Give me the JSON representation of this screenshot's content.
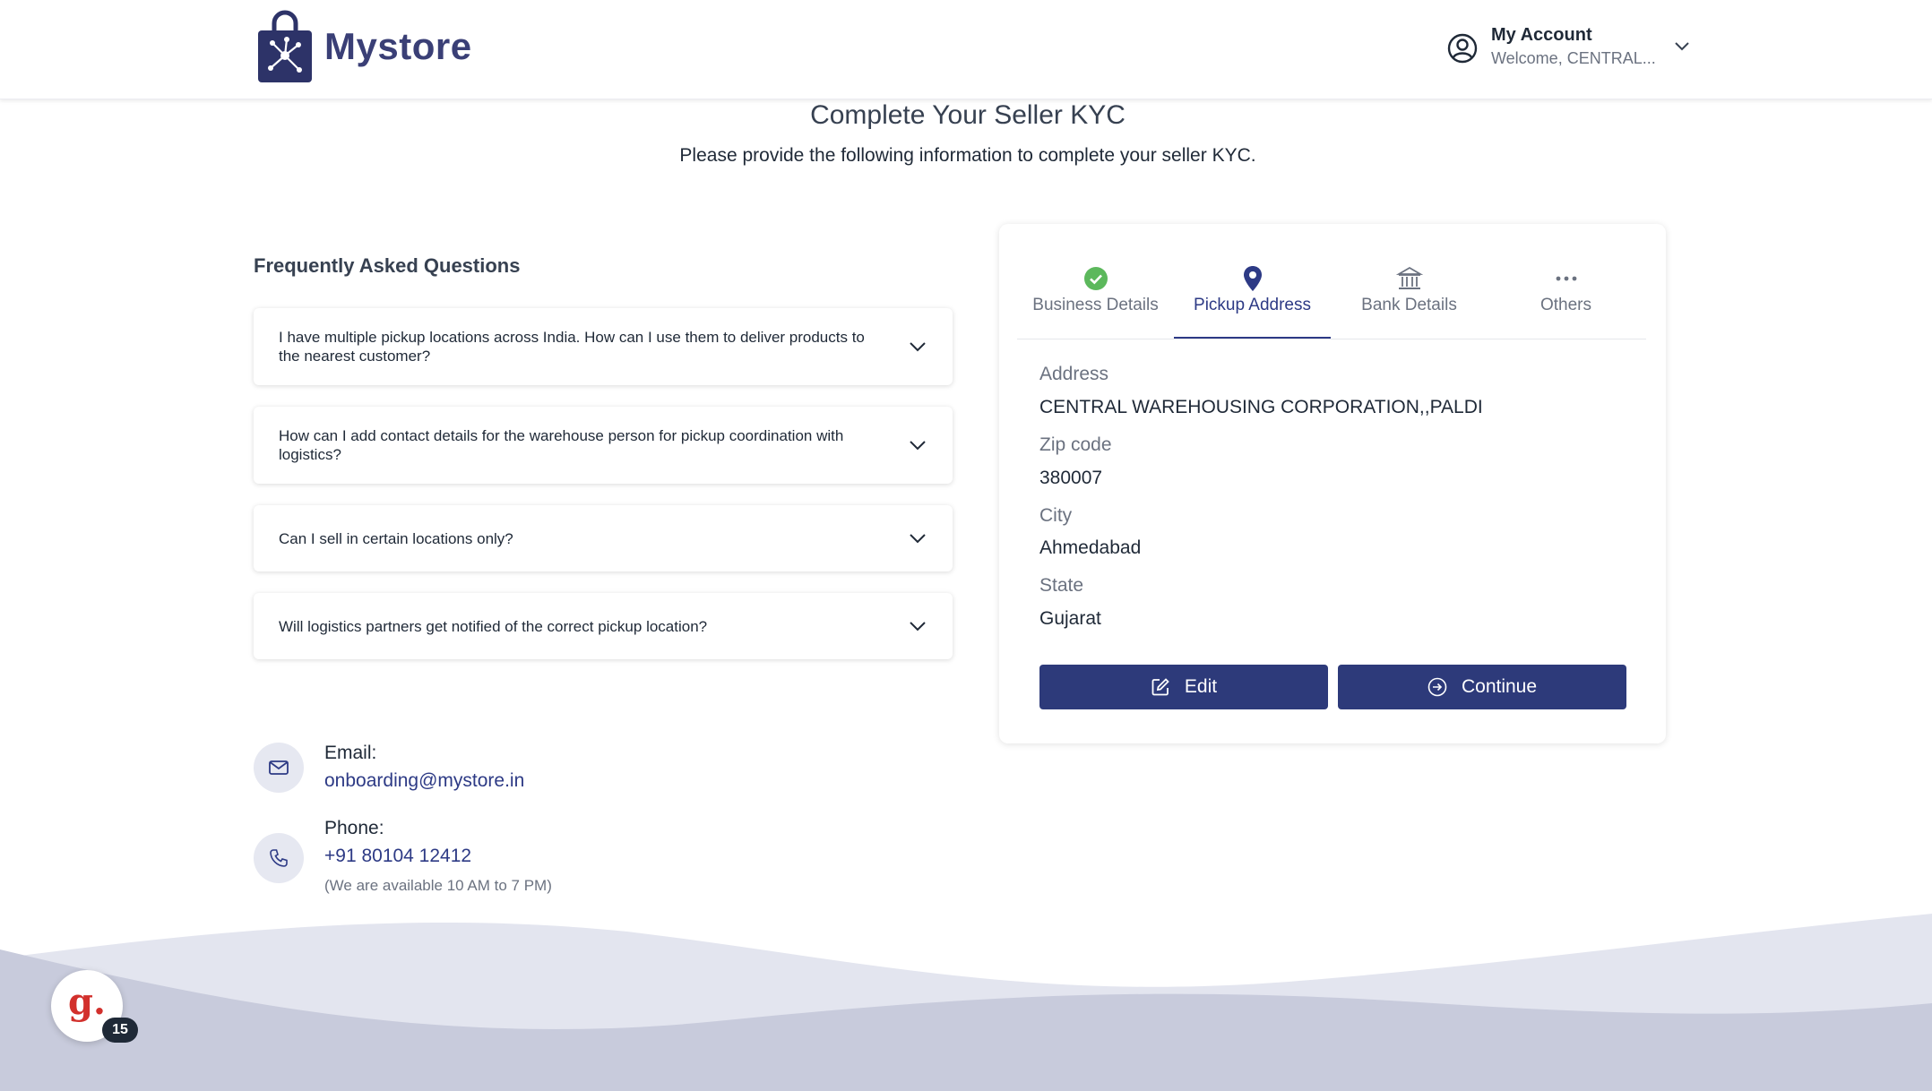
{
  "brand": {
    "name": "Mystore",
    "color": "#3a3f76"
  },
  "account": {
    "title": "My Account",
    "subtitle": "Welcome, CENTRAL..."
  },
  "page": {
    "title": "Complete Your Seller KYC",
    "subtitle": "Please provide the following information to complete your seller KYC."
  },
  "faq": {
    "heading": "Frequently Asked Questions",
    "items": [
      {
        "question": "I have multiple pickup locations across India. How can I use them to deliver products to the nearest customer?"
      },
      {
        "question": "How can I add contact details for the warehouse person for pickup coordination with logistics?"
      },
      {
        "question": "Can I sell in certain locations only?"
      },
      {
        "question": "Will logistics partners get notified of the correct pickup location?"
      }
    ]
  },
  "contact": {
    "email_label": "Email:",
    "email": "onboarding@mystore.in",
    "phone_label": "Phone:",
    "phone": "+91 80104 12412",
    "availability": "(We are available 10 AM to 7 PM)"
  },
  "kyc": {
    "tabs": [
      {
        "label": "Business Details",
        "icon": "check-circle-icon",
        "state": "completed"
      },
      {
        "label": "Pickup Address",
        "icon": "map-pin-icon",
        "state": "active"
      },
      {
        "label": "Bank Details",
        "icon": "bank-icon",
        "state": "pending"
      },
      {
        "label": "Others",
        "icon": "more-dots-icon",
        "state": "pending"
      }
    ],
    "fields": {
      "address": {
        "label": "Address",
        "value": "CENTRAL WAREHOUSING CORPORATION,,PALDI"
      },
      "zip": {
        "label": "Zip code",
        "value": "380007"
      },
      "city": {
        "label": "City",
        "value": "Ahmedabad"
      },
      "state": {
        "label": "State",
        "value": "Gujarat"
      }
    },
    "buttons": {
      "edit": "Edit",
      "continue": "Continue"
    }
  },
  "widget": {
    "glyph": "g.",
    "badge": "15"
  },
  "colors": {
    "primary": "#2d3a7a",
    "success": "#5cb85c",
    "wave_light": "#e3e5ef",
    "wave_dark": "#c8cbdc"
  }
}
